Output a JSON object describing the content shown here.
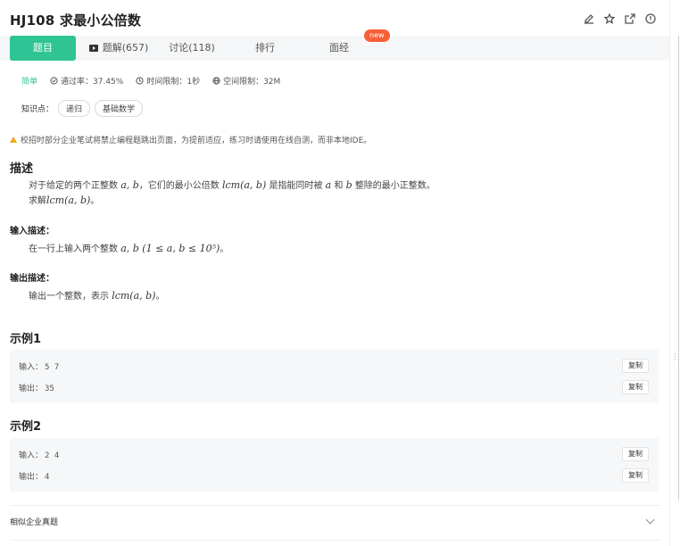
{
  "problem": {
    "title": "HJ108  求最小公倍数",
    "actions": [
      "edit-icon",
      "star-icon",
      "share-icon",
      "info-icon"
    ]
  },
  "tabs": [
    {
      "label": "题目",
      "active": true
    },
    {
      "label": "题解(657)",
      "icon": "video-icon"
    },
    {
      "label": "讨论(118)"
    },
    {
      "label": "排行"
    },
    {
      "label": "面经"
    }
  ],
  "new_badge": "new",
  "meta": {
    "difficulty": "简单",
    "pass_rate": "通过率：37.45%",
    "time_limit": "时间限制：1秒",
    "memory_limit": "空间限制：32M"
  },
  "knowledge": {
    "label": "知识点：",
    "tags": [
      "递归",
      "基础数学"
    ]
  },
  "notice": "校招时部分企业笔试将禁止编程题跳出页面，为提前适应，练习时请使用在线自测，而非本地IDE。",
  "description": {
    "heading": "描述",
    "line1_a": "对于给定的两个正整数",
    "line1_math1": "a, b",
    "line1_b": "，它们的最小公倍数",
    "line1_math2": "lcm(a, b)",
    "line1_c": "是指能同时被",
    "line1_math3": "a",
    "line1_d": "和",
    "line1_math4": "b",
    "line1_e": "整除的最小正整数。",
    "line2_a": "求解",
    "line2_math": "lcm(a, b)",
    "line2_b": "。"
  },
  "input_desc": {
    "heading": "输入描述：",
    "text_a": "在一行上输入两个整数",
    "math": "a, b (1 ≤ a, b ≤ 10⁵)",
    "text_b": "。"
  },
  "output_desc": {
    "heading": "输出描述：",
    "text_a": "输出一个整数，表示",
    "math": "lcm(a, b)",
    "text_b": "。"
  },
  "examples": [
    {
      "heading": "示例1",
      "input_label": "输入：",
      "input_value": "5 7",
      "output_label": "输出：",
      "output_value": "35",
      "copy_label": "复制"
    },
    {
      "heading": "示例2",
      "input_label": "输入：",
      "input_value": "2 4",
      "output_label": "输出：",
      "output_value": "4",
      "copy_label": "复制"
    }
  ],
  "similar": {
    "label": "相似企业真题"
  },
  "colors": {
    "accent": "#2fc493",
    "new_badge": "#f75f36",
    "warning": "#f5a623"
  }
}
